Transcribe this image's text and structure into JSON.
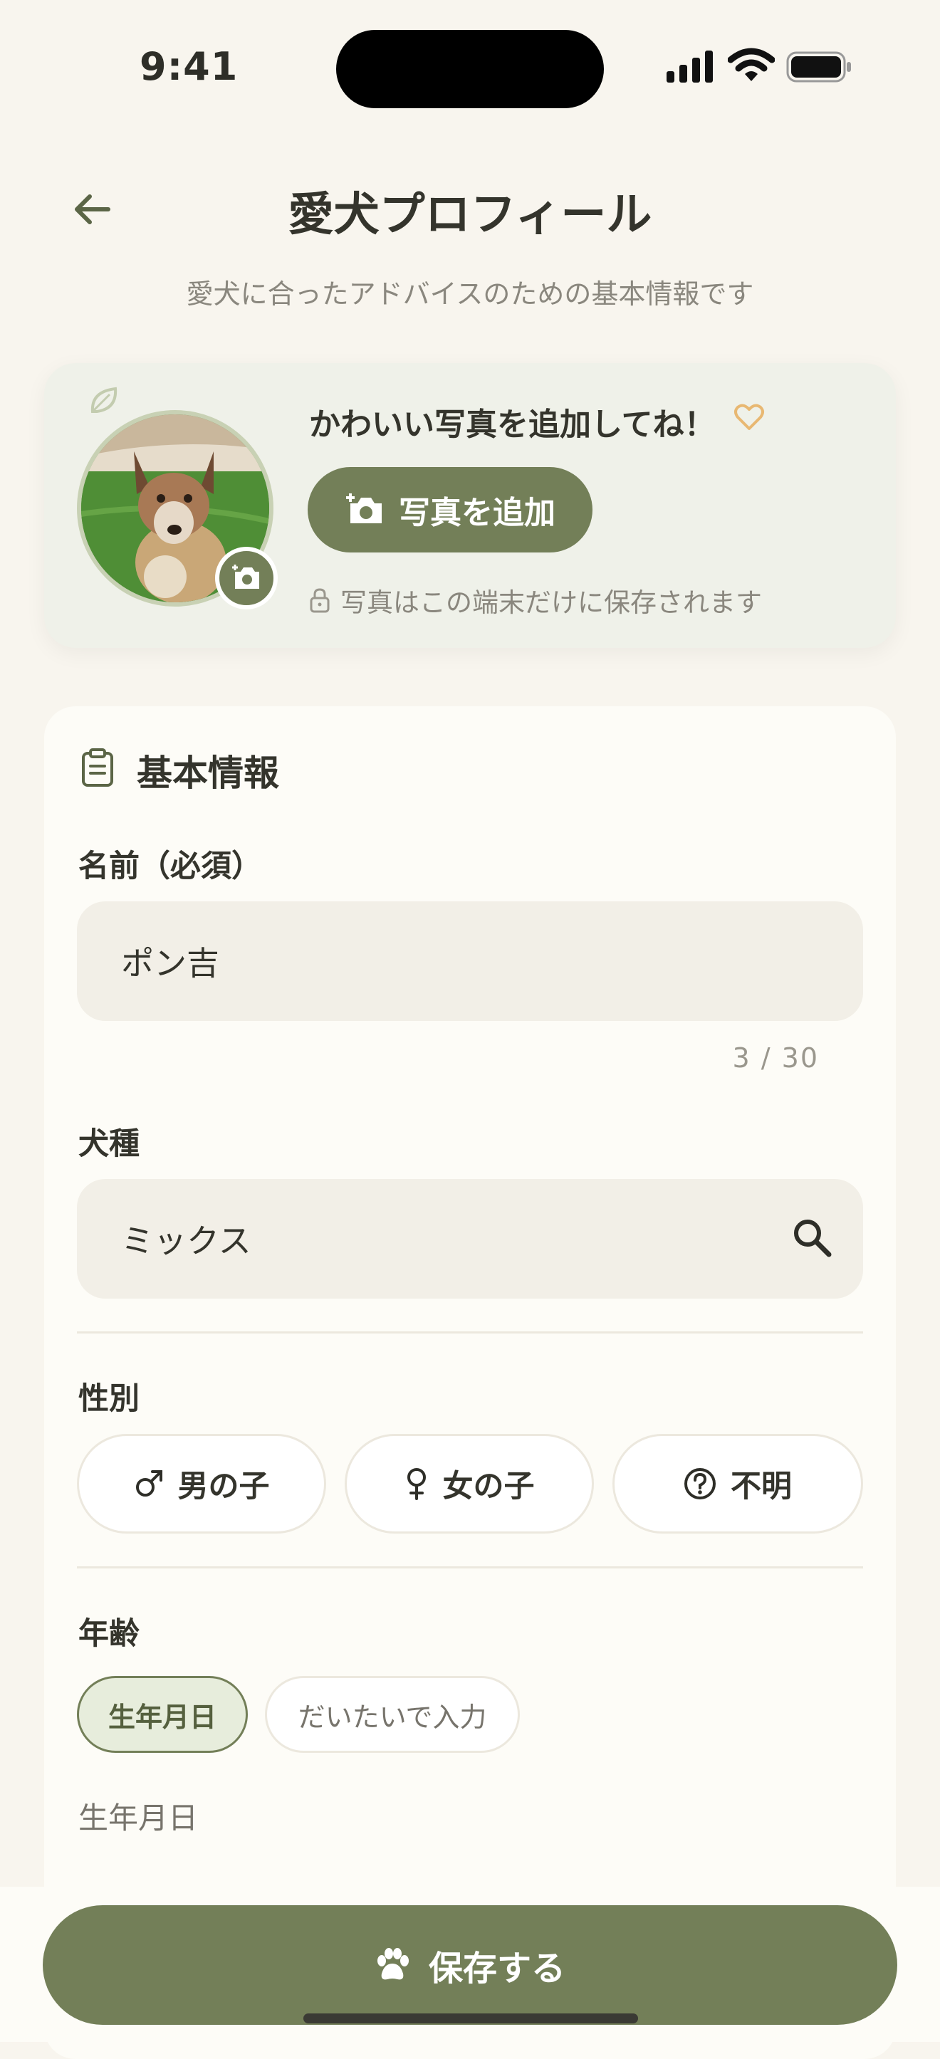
{
  "status_bar": {
    "time": "9:41"
  },
  "header": {
    "title": "愛犬プロフィール",
    "subtitle": "愛犬に合ったアドバイスのための基本情報です"
  },
  "photo_card": {
    "heading": "かわいい写真を追加してね！",
    "add_button_label": "写真を追加",
    "privacy_note": "写真はこの端末だけに保存されます"
  },
  "basic_info": {
    "section_title": "基本情報",
    "name": {
      "label": "名前（必須）",
      "value": "ポン吉",
      "counter": "3 / 30"
    },
    "breed": {
      "label": "犬種",
      "value": "ミックス"
    },
    "sex": {
      "label": "性別",
      "options": [
        "男の子",
        "女の子",
        "不明"
      ]
    },
    "age": {
      "label": "年齢",
      "modes": [
        "生年月日",
        "だいたいで入力"
      ],
      "selected_mode": "生年月日",
      "sub_label": "生年月日"
    }
  },
  "footer": {
    "save_label": "保存する"
  },
  "colors": {
    "background": "#f8f5ee",
    "accent": "#737f58",
    "card": "#fdfcf7",
    "field": "#f2efe7",
    "heart": "#e8b872"
  }
}
